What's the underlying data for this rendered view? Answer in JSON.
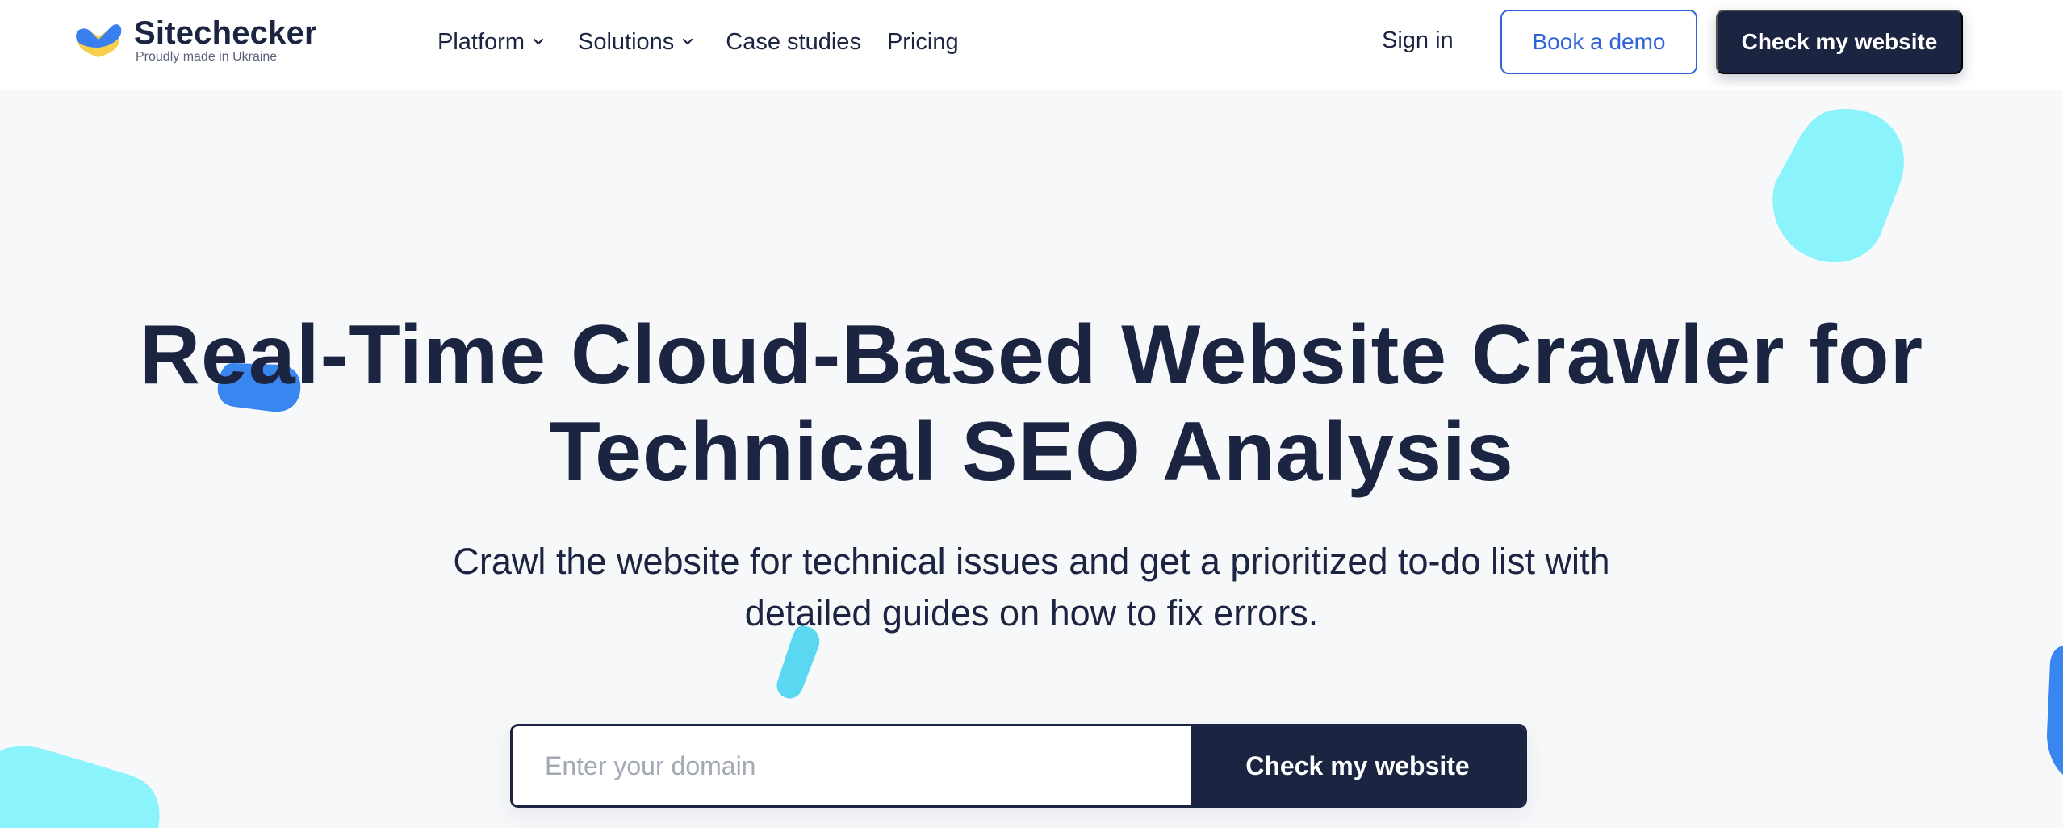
{
  "brand": {
    "name": "Sitechecker",
    "tagline": "Proudly made in Ukraine"
  },
  "nav": {
    "items": [
      {
        "label": "Platform",
        "icon": "chevron-down-icon"
      },
      {
        "label": "Solutions",
        "icon": "chevron-down-icon"
      },
      {
        "label": "Case studies"
      },
      {
        "label": "Pricing"
      }
    ],
    "sign_in": "Sign in",
    "book_demo": "Book a demo",
    "check_website": "Check my website"
  },
  "hero": {
    "title_line1": "Real-Time Cloud-Based Website Crawler for",
    "title_line2": "Technical SEO Analysis",
    "subtitle_line1": "Crawl the website for technical issues and get a prioritized to-do list with",
    "subtitle_line2": "detailed guides on how to fix errors."
  },
  "search": {
    "placeholder": "Enter your domain",
    "value": "",
    "button_label": "Check my website"
  },
  "colors": {
    "navy": "#1b2440",
    "accent_blue": "#2f64d8",
    "blob_cyan": "#8af3fb",
    "blob_blue": "#3a86f0",
    "logo_yellow": "#f7cf4a",
    "background": "#f7f8fa"
  }
}
